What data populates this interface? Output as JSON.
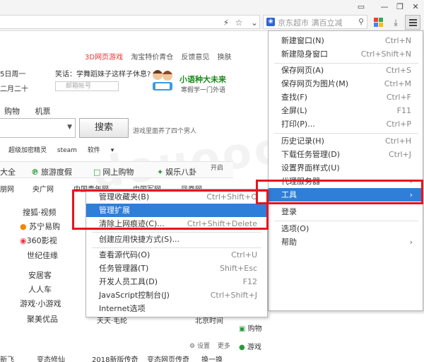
{
  "toolbar": {
    "search_placeholder": "京东超市 满百立减",
    "colors": {
      "accent": "#2f7fd8",
      "annotation": "#e8131e"
    }
  },
  "page": {
    "topnav": [
      "3D网页游戏",
      "淘宝特价青仓",
      "反馈意见",
      "换肤"
    ],
    "date_line1": "5日周一",
    "date_line2": "二月二十",
    "joke": "笑话：学舞蹈妹子这样子休息?",
    "mail_placeholder": "邮箱帐号",
    "brand_title": "小语种大未来",
    "brand_sub": "寒假学一门外语",
    "tabs": [
      "购物",
      "机票"
    ],
    "search_button": "搜索",
    "search_ad": "游戏里面养了四个男人",
    "keywords": [
      "超级加密精灵",
      "steam",
      "软件"
    ],
    "categories": [
      "大全",
      "旅游度假",
      "网上购物",
      "娱乐八卦"
    ],
    "kaiqi": "开启",
    "sites": [
      "朋网",
      "央广网",
      "中国青年网",
      "中国军网",
      "凤凰网"
    ],
    "left_links": [
      "搜狐·视频",
      "苏宁易购",
      "360影视",
      "世纪佳缘",
      "安居客",
      "人人车",
      "游戏·小游戏",
      "聚美优品"
    ],
    "side_links": [
      "购物",
      "游戏"
    ],
    "settings": [
      "设置",
      "更多"
    ],
    "bottom_links": [
      "新飞",
      "变态修仙",
      "2018新版传奇",
      "变态网页传奇",
      "换一换"
    ],
    "extra_text": [
      "天天·毛纶",
      "北京时间"
    ],
    "watermark": "douooo.com"
  },
  "main_menu": {
    "items": [
      {
        "label": "新建窗口(N)",
        "shortcut": "Ctrl+N"
      },
      {
        "label": "新建隐身窗口",
        "shortcut": "Ctrl+Shift+N"
      },
      {
        "label": "保存网页(A)",
        "shortcut": "Ctrl+S"
      },
      {
        "label": "保存网页为图片(M)",
        "shortcut": "Ctrl+M"
      },
      {
        "label": "查找(F)",
        "shortcut": "Ctrl+F"
      },
      {
        "label": "全屏(L)",
        "shortcut": "F11"
      },
      {
        "label": "打印(P)...",
        "shortcut": "Ctrl+P"
      },
      {
        "label": "历史记录(H)",
        "shortcut": "Ctrl+H"
      },
      {
        "label": "下载任务管理(D)",
        "shortcut": "Ctrl+J"
      },
      {
        "label": "设置界面样式(U)",
        "shortcut": ""
      },
      {
        "label": "代理服务器",
        "shortcut": ""
      },
      {
        "label": "工具",
        "shortcut": ""
      },
      {
        "label": "登录",
        "shortcut": ""
      },
      {
        "label": "选项(O)",
        "shortcut": ""
      },
      {
        "label": "帮助",
        "shortcut": ""
      }
    ]
  },
  "sub_menu": {
    "items": [
      {
        "label": "管理收藏夹(B)",
        "shortcut": "Ctrl+Shift+O"
      },
      {
        "label": "管理扩展",
        "shortcut": ""
      },
      {
        "label": "清除上网痕迹(C)...",
        "shortcut": "Ctrl+Shift+Delete"
      },
      {
        "label": "创建应用快捷方式(S)...",
        "shortcut": ""
      },
      {
        "label": "查看源代码(O)",
        "shortcut": "Ctrl+U"
      },
      {
        "label": "任务管理器(T)",
        "shortcut": "Shift+Esc"
      },
      {
        "label": "开发人员工具(D)",
        "shortcut": "F12"
      },
      {
        "label": "JavaScript控制台(J)",
        "shortcut": "Ctrl+Shift+J"
      },
      {
        "label": "Internet选项",
        "shortcut": ""
      }
    ]
  }
}
